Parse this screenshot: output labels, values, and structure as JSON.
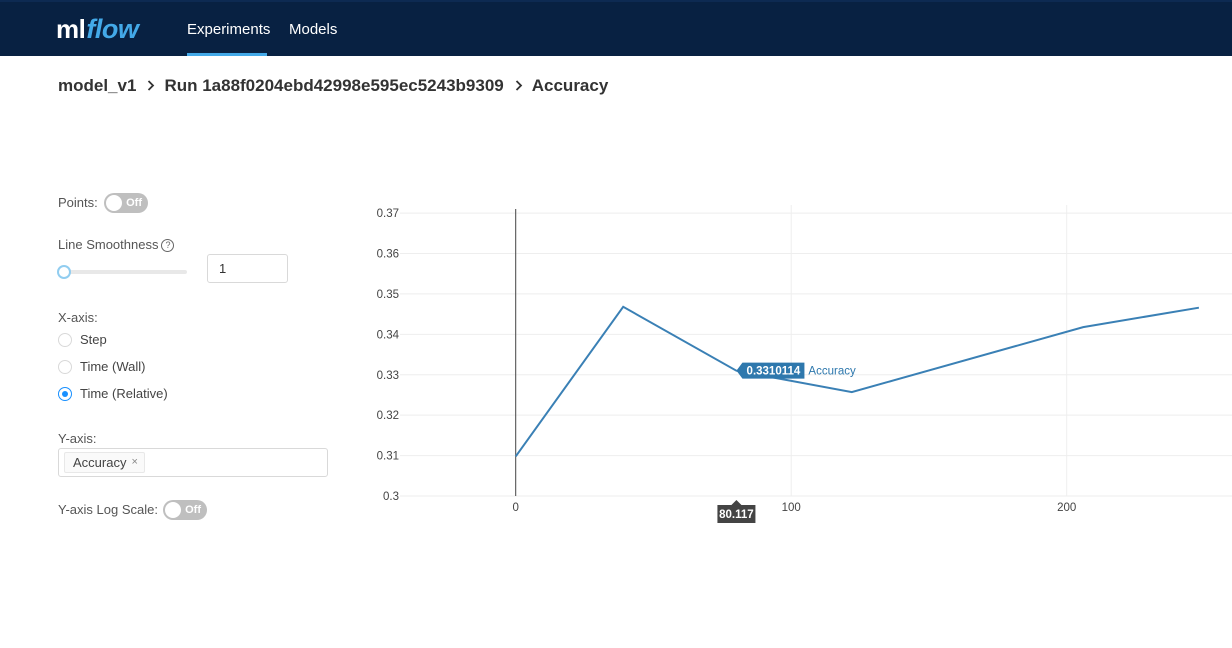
{
  "topbar": {
    "logo_ml": "ml",
    "logo_flow": "flow",
    "tabs": [
      {
        "label": "Experiments",
        "active": true
      },
      {
        "label": "Models",
        "active": false
      }
    ],
    "accent": "#43a9e8",
    "background": "#082142"
  },
  "breadcrumb": {
    "experiment": "model_v1",
    "run": "Run 1a88f0204ebd42998e595ec5243b9309",
    "metric": "Accuracy",
    "separator": ">"
  },
  "controls": {
    "points_label": "Points:",
    "points_toggle": "Off",
    "smoothness_label": "Line Smoothness",
    "smoothness_help_icon": "?",
    "smoothness_value": "1",
    "xaxis_label": "X-axis:",
    "xaxis_options": [
      {
        "label": "Step",
        "checked": false
      },
      {
        "label": "Time (Wall)",
        "checked": false
      },
      {
        "label": "Time (Relative)",
        "checked": true
      }
    ],
    "yaxis_label": "Y-axis:",
    "yaxis_tag": "Accuracy",
    "yaxis_tag_remove": "×",
    "log_scale_label": "Y-axis Log Scale:",
    "log_scale_toggle": "Off"
  },
  "chart_data": {
    "type": "line",
    "series": [
      {
        "name": "Accuracy",
        "color": "#3a80b5",
        "x": [
          0,
          39,
          80.117,
          122,
          206,
          248
        ],
        "y": [
          0.3098,
          0.3468,
          0.3310114,
          0.3257,
          0.3418,
          0.3466
        ]
      }
    ],
    "xlim": [
      -42,
      260
    ],
    "ylim": [
      0.3,
      0.372
    ],
    "xticks": [
      0,
      100,
      200
    ],
    "yticks": [
      0.3,
      0.31,
      0.32,
      0.33,
      0.34,
      0.35,
      0.36,
      0.37
    ],
    "grid": true,
    "hover": {
      "x_label": "80.117",
      "y_label": "0.3310114",
      "series_label": "Accuracy",
      "x": 80.117,
      "y": 0.3310114
    }
  }
}
